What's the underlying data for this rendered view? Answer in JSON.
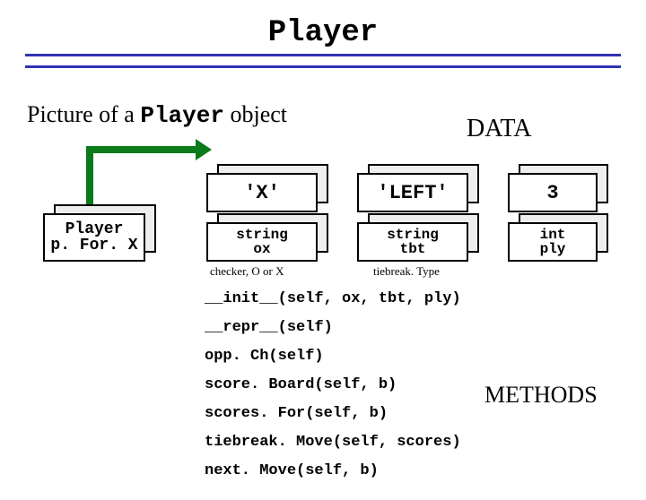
{
  "title": "Player",
  "subtitle_prefix": "Picture of a ",
  "subtitle_mono": "Player",
  "subtitle_suffix": " object",
  "labels": {
    "data": "DATA",
    "methods": "METHODS"
  },
  "player_box": {
    "line1": "Player",
    "line2": "p. For. X"
  },
  "fields": {
    "ox": {
      "value": "'X'",
      "type": "string",
      "name": "ox",
      "caption": "checker, O or X"
    },
    "tbt": {
      "value": "'LEFT'",
      "type": "string",
      "name": "tbt",
      "caption": "tiebreak. Type"
    },
    "ply": {
      "value": "3",
      "type": "int",
      "name": "ply",
      "caption": ""
    }
  },
  "methods": [
    "__init__(self, ox, tbt, ply)",
    "__repr__(self)",
    "opp. Ch(self)",
    "score. Board(self, b)",
    "scores. For(self, b)",
    "tiebreak. Move(self, scores)",
    "next. Move(self, b)"
  ]
}
